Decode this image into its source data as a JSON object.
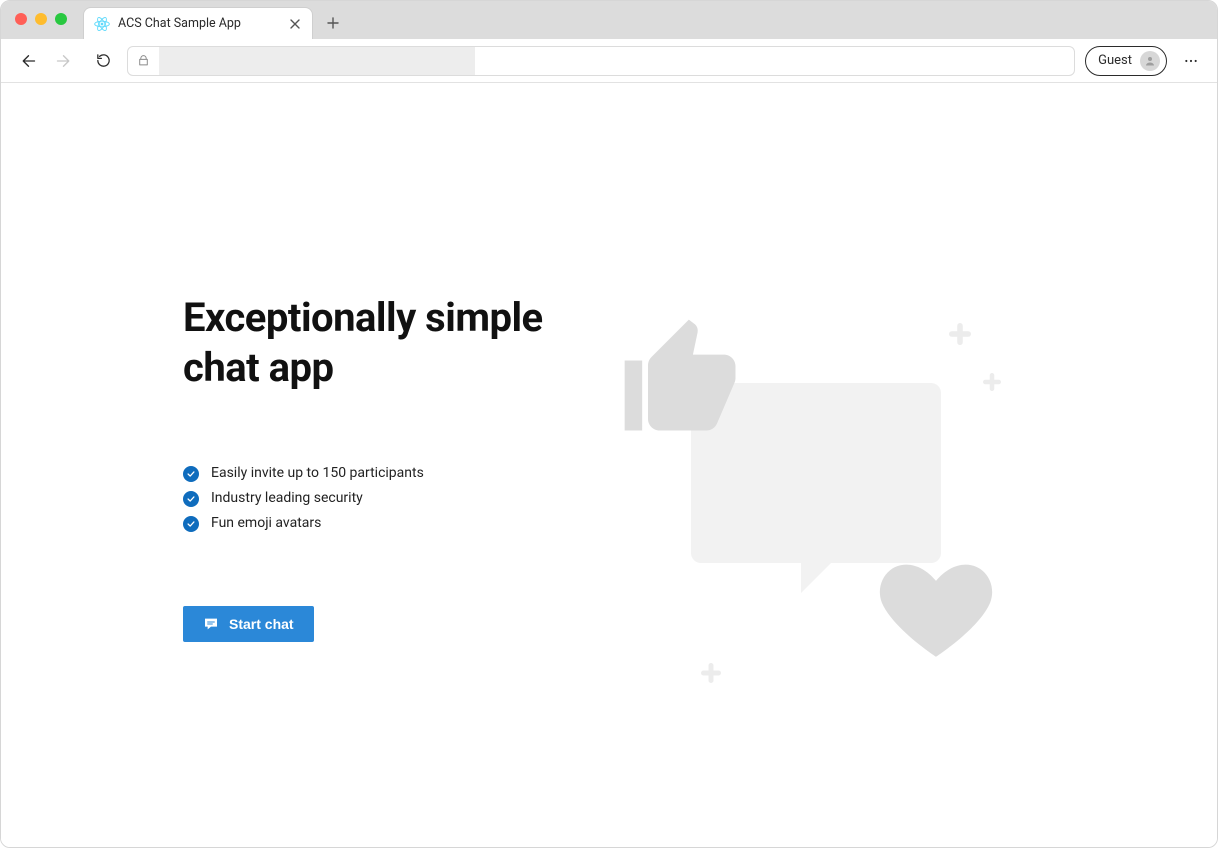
{
  "browser": {
    "tab_title": "ACS Chat Sample App",
    "guest_label": "Guest",
    "address_value": ""
  },
  "hero": {
    "title_line1": "Exceptionally simple",
    "title_line2": "chat app"
  },
  "features": [
    "Easily invite up to 150 participants",
    "Industry leading security",
    "Fun emoji avatars"
  ],
  "cta": {
    "label": "Start chat"
  }
}
